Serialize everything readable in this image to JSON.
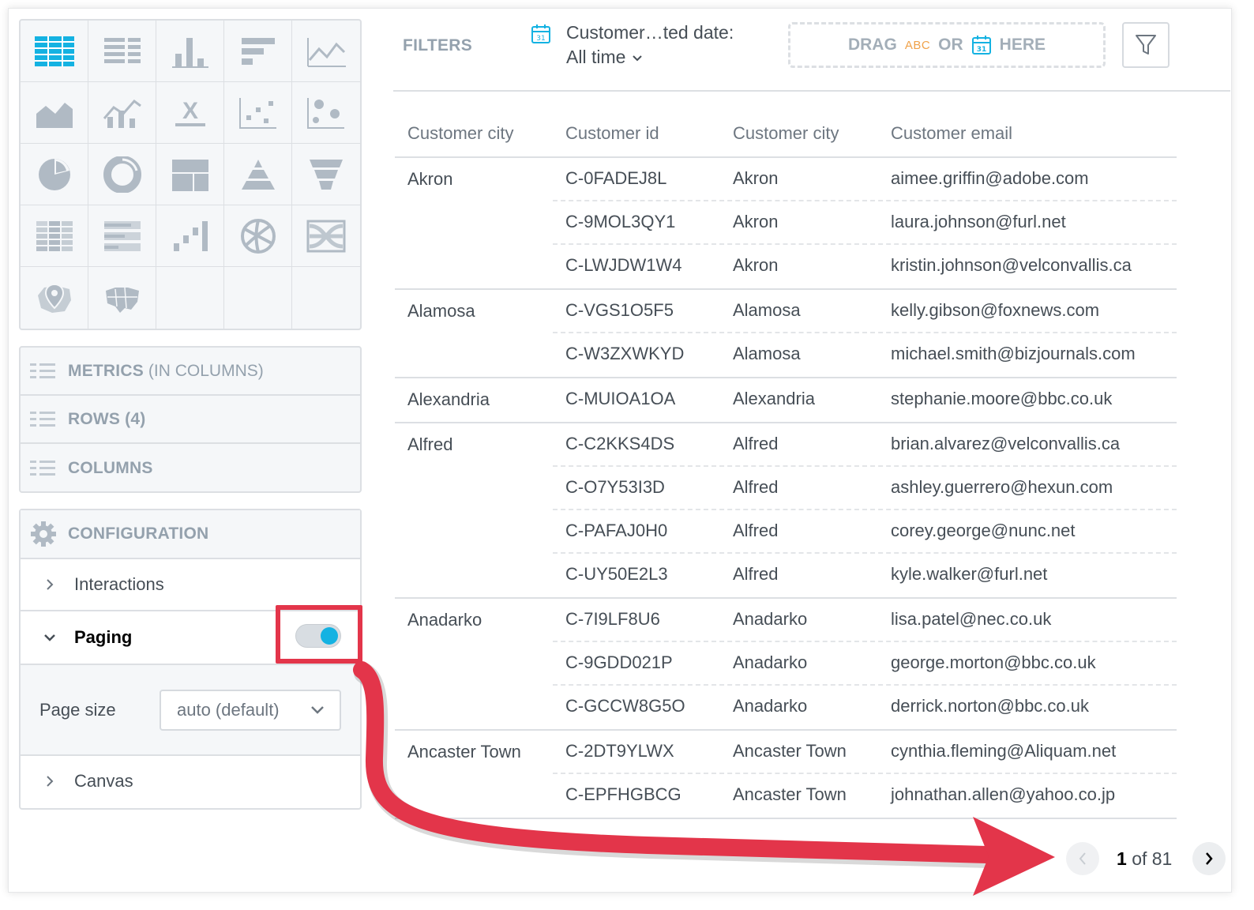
{
  "visualization_picker": {
    "icons": [
      "table-icon",
      "headline-icon",
      "column-chart-icon",
      "bar-chart-icon",
      "line-chart-icon",
      "area-chart-icon",
      "combo-chart-icon",
      "headline-x-icon",
      "scatter-plot-icon",
      "bubble-chart-icon",
      "pie-chart-icon",
      "donut-chart-icon",
      "treemap-icon",
      "pyramid-chart-icon",
      "funnel-chart-icon",
      "heatmap-icon",
      "bullet-chart-icon",
      "waterfall-chart-icon",
      "dependency-wheel-icon",
      "sankey-icon",
      "pushpin-map-icon",
      "region-map-icon"
    ],
    "selected": "table-icon"
  },
  "buckets": {
    "metrics_title": "METRICS",
    "metrics_sub": "(IN COLUMNS)",
    "rows_title": "ROWS (4)",
    "columns_title": "COLUMNS"
  },
  "configuration": {
    "title": "CONFIGURATION",
    "interactions_label": "Interactions",
    "paging_label": "Paging",
    "paging_enabled": true,
    "page_size_label": "Page size",
    "page_size_value": "auto (default)",
    "canvas_label": "Canvas"
  },
  "filters": {
    "label": "FILTERS",
    "date_filter_title": "Customer…ted date:",
    "date_filter_value": "All time",
    "drop_zone": {
      "drag": "DRAG",
      "abc": "ABC",
      "or": "OR",
      "here": "HERE"
    }
  },
  "table": {
    "headers": [
      "Customer city",
      "Customer id",
      "Customer city",
      "Customer email"
    ],
    "groups": [
      {
        "city": "Akron",
        "rows": [
          {
            "id": "C-0FADEJ8L",
            "city": "Akron",
            "email": "aimee.griffin@adobe.com"
          },
          {
            "id": "C-9MOL3QY1",
            "city": "Akron",
            "email": "laura.johnson@furl.net"
          },
          {
            "id": "C-LWJDW1W4",
            "city": "Akron",
            "email": "kristin.johnson@velconvallis.ca"
          }
        ]
      },
      {
        "city": "Alamosa",
        "rows": [
          {
            "id": "C-VGS1O5F5",
            "city": "Alamosa",
            "email": "kelly.gibson@foxnews.com"
          },
          {
            "id": "C-W3ZXWKYD",
            "city": "Alamosa",
            "email": "michael.smith@bizjournals.com"
          }
        ]
      },
      {
        "city": "Alexandria",
        "rows": [
          {
            "id": "C-MUIOA1OA",
            "city": "Alexandria",
            "email": "stephanie.moore@bbc.co.uk"
          }
        ]
      },
      {
        "city": "Alfred",
        "rows": [
          {
            "id": "C-C2KKS4DS",
            "city": "Alfred",
            "email": "brian.alvarez@velconvallis.ca"
          },
          {
            "id": "C-O7Y53I3D",
            "city": "Alfred",
            "email": "ashley.guerrero@hexun.com"
          },
          {
            "id": "C-PAFAJ0H0",
            "city": "Alfred",
            "email": "corey.george@nunc.net"
          },
          {
            "id": "C-UY50E2L3",
            "city": "Alfred",
            "email": "kyle.walker@furl.net"
          }
        ]
      },
      {
        "city": "Anadarko",
        "rows": [
          {
            "id": "C-7I9LF8U6",
            "city": "Anadarko",
            "email": "lisa.patel@nec.co.uk"
          },
          {
            "id": "C-9GDD021P",
            "city": "Anadarko",
            "email": "george.morton@bbc.co.uk"
          },
          {
            "id": "C-GCCW8G5O",
            "city": "Anadarko",
            "email": "derrick.norton@bbc.co.uk"
          }
        ]
      },
      {
        "city": "Ancaster Town",
        "rows": [
          {
            "id": "C-2DT9YLWX",
            "city": "Ancaster Town",
            "email": "cynthia.fleming@Aliquam.net"
          },
          {
            "id": "C-EPFHGBCG",
            "city": "Ancaster Town",
            "email": "johnathan.allen@yahoo.co.jp"
          }
        ]
      }
    ]
  },
  "pagination": {
    "current": "1",
    "of_text": "of 81"
  },
  "colors": {
    "accent": "#14b2e2",
    "highlight": "#e3354a",
    "icon_gray": "#b0bac4",
    "selected_icon": "#14b2e2"
  }
}
